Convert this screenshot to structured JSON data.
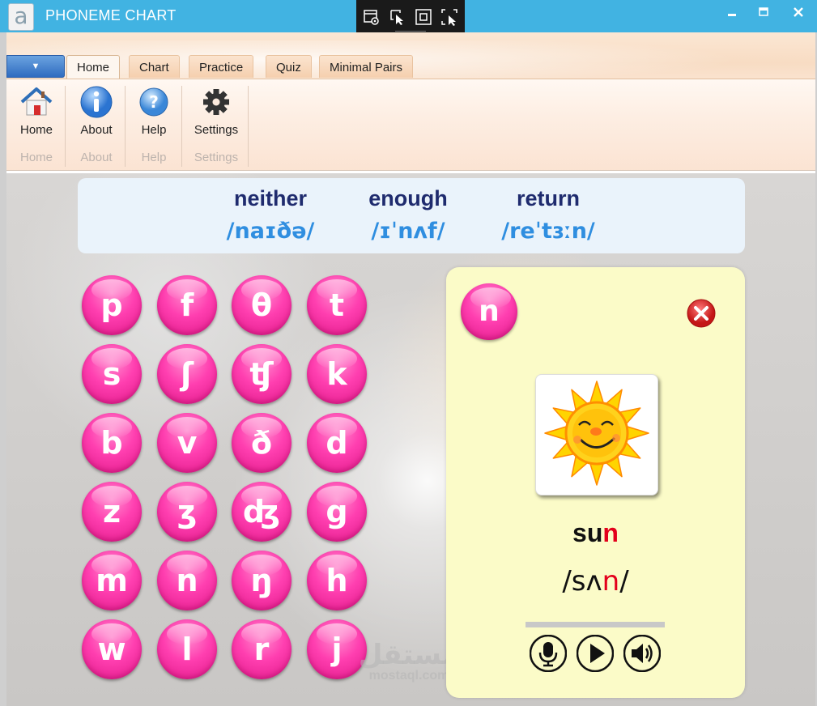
{
  "window": {
    "title": "PHONEME CHART",
    "logo_letter": "a",
    "titlebar_color": "#41b3e2",
    "controls": [
      "minimize-icon",
      "maximize-icon",
      "close-icon"
    ]
  },
  "capture_toolbar": {
    "icons": [
      "window-capture-icon",
      "pointer-select-icon",
      "fullscreen-capture-icon",
      "region-capture-icon"
    ]
  },
  "ribbon": {
    "app_menu_icon": "dropdown-arrow-icon",
    "tabs": [
      {
        "label": "Home",
        "active": true
      },
      {
        "label": "Chart",
        "active": false
      },
      {
        "label": "Practice",
        "active": false
      },
      {
        "label": "Quiz",
        "active": false
      },
      {
        "label": "Minimal Pairs",
        "active": false
      }
    ],
    "buttons": [
      {
        "label": "Home",
        "group": "Home",
        "icon": "house-icon"
      },
      {
        "label": "About",
        "group": "About",
        "icon": "info-icon"
      },
      {
        "label": "Help",
        "group": "Help",
        "icon": "help-icon"
      },
      {
        "label": "Settings",
        "group": "Settings",
        "icon": "gear-icon"
      }
    ]
  },
  "examples": [
    {
      "word": "neither",
      "ipa": "/naɪðə/"
    },
    {
      "word": "enough",
      "ipa": "/ɪˈnʌf/"
    },
    {
      "word": "return",
      "ipa": "/reˈtɜːn/"
    }
  ],
  "phonemes": [
    [
      "p",
      "f",
      "θ",
      "t"
    ],
    [
      "s",
      "ʃ",
      "ʧ",
      "k"
    ],
    [
      "b",
      "v",
      "ð",
      "d"
    ],
    [
      "z",
      "ʒ",
      "ʤ",
      "g"
    ],
    [
      "m",
      "n",
      "ŋ",
      "h"
    ],
    [
      "w",
      "l",
      "r",
      "j"
    ]
  ],
  "phoneme_color": "#ff3fb0",
  "detail": {
    "phoneme": "n",
    "picture": "sun-picture",
    "word_prefix": "su",
    "word_highlight": "n",
    "ipa_prefix": "/sʌ",
    "ipa_highlight": "n",
    "ipa_suffix": "/",
    "highlight_color": "#e3001b",
    "card_color": "#fbfbc8",
    "controls": [
      "microphone-icon",
      "play-icon",
      "speaker-icon"
    ]
  },
  "watermark": {
    "main": "مستقل",
    "sub": "mostaql.com"
  }
}
